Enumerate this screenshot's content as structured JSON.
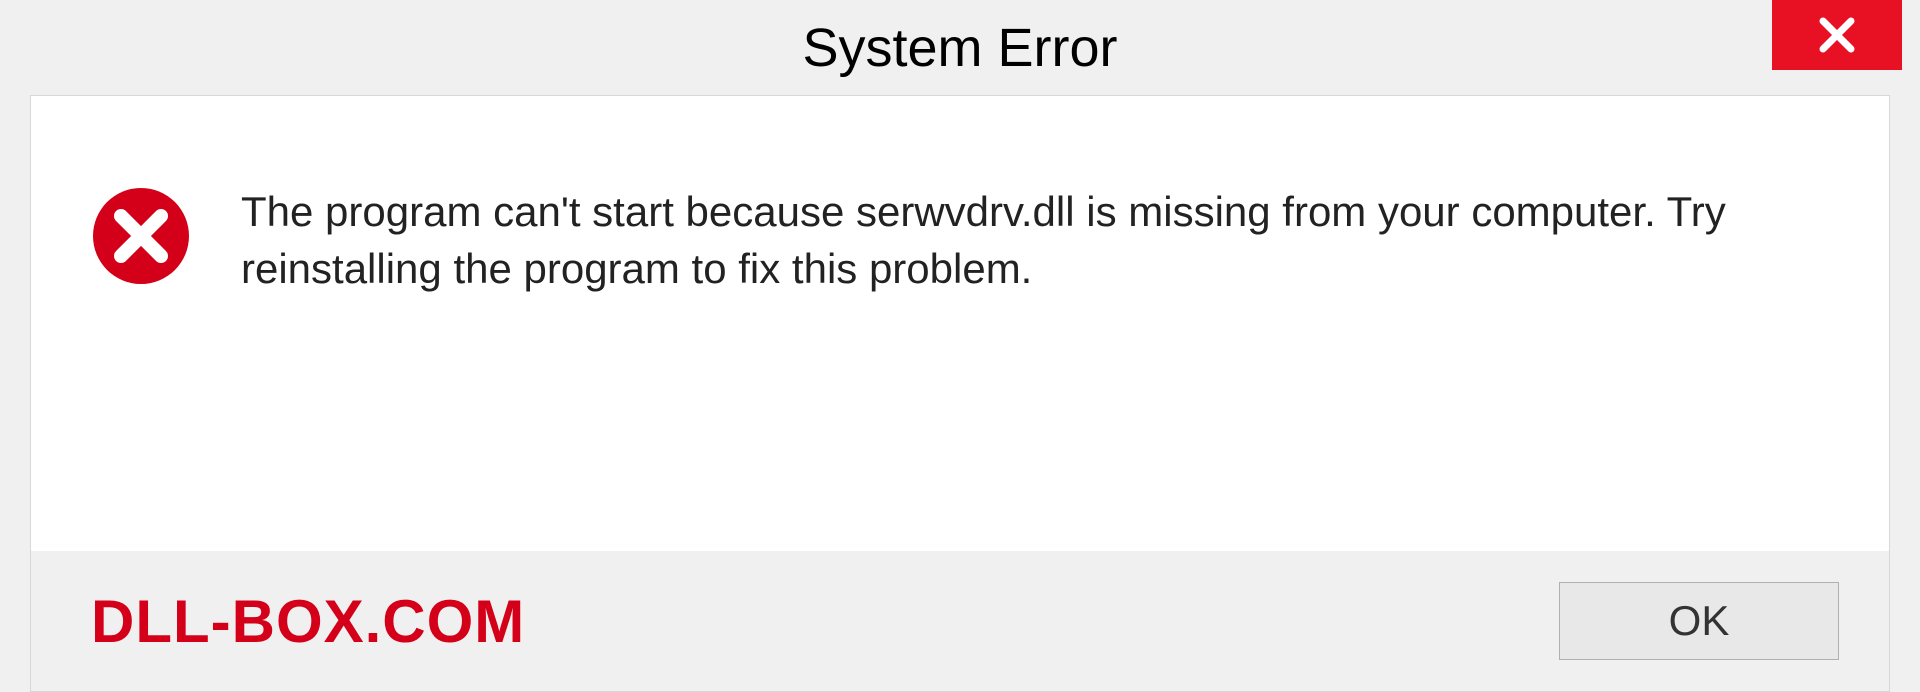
{
  "dialog": {
    "title": "System Error",
    "message": "The program can't start because serwvdrv.dll is missing from your computer. Try reinstalling the program to fix this problem.",
    "watermark": "DLL-BOX.COM",
    "ok_label": "OK"
  }
}
